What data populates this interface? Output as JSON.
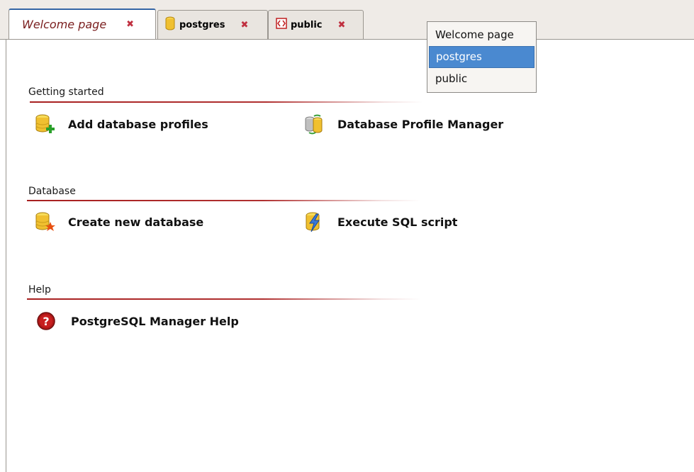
{
  "tabs": [
    {
      "label": "Welcome page",
      "icon": "none",
      "close": "✖"
    },
    {
      "label": "postgres",
      "icon": "database-icon",
      "close": "✖"
    },
    {
      "label": "public",
      "icon": "schema-icon",
      "close": "✖"
    }
  ],
  "tab_menu": {
    "items": [
      "Welcome page",
      "postgres",
      "public"
    ],
    "selected": "postgres"
  },
  "sections": [
    {
      "title": "Getting started",
      "actions": [
        {
          "label": "Add database profiles",
          "icon": "add-database-icon"
        },
        {
          "label": "Database Profile Manager",
          "icon": "profile-manager-icon"
        }
      ]
    },
    {
      "title": "Database",
      "actions": [
        {
          "label": "Create new database",
          "icon": "create-database-icon"
        },
        {
          "label": "Execute SQL script",
          "icon": "execute-sql-icon"
        }
      ]
    },
    {
      "title": "Help",
      "actions": [
        {
          "label": "PostgreSQL Manager Help",
          "icon": "help-icon"
        }
      ]
    }
  ],
  "colors": {
    "accent": "#3465a4",
    "rule": "#a82020",
    "selection": "#4a89d0",
    "close": "#c03040"
  }
}
